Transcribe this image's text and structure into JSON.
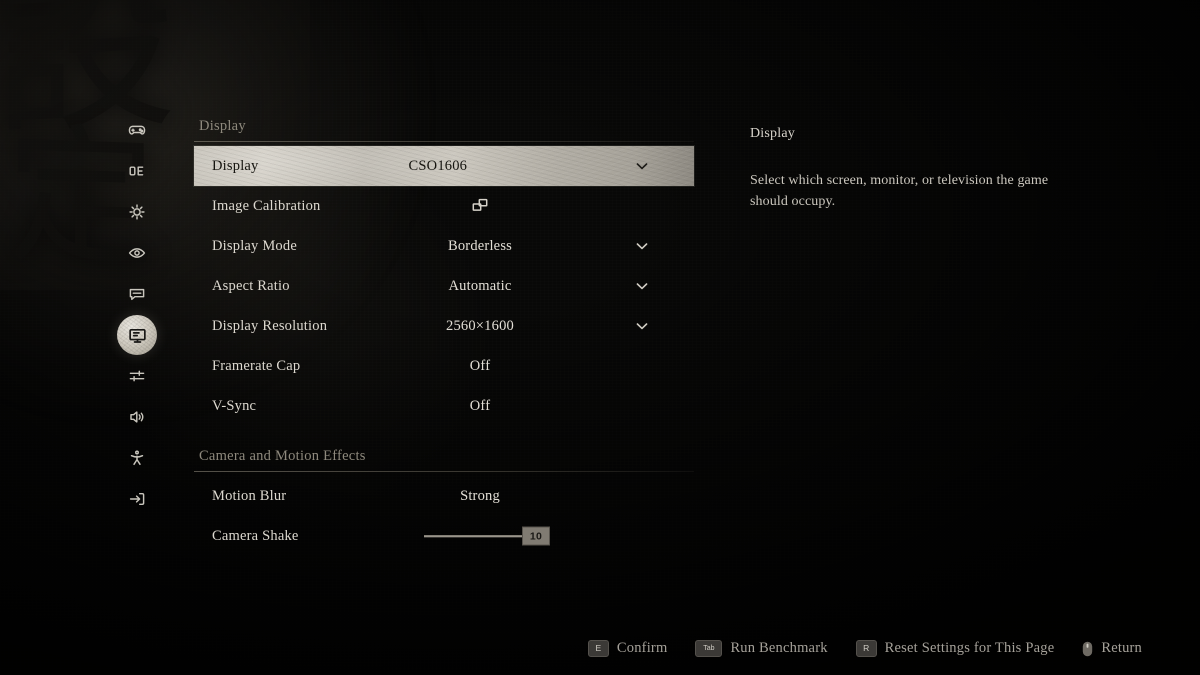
{
  "background": {
    "calligraphy_top": "設",
    "calligraphy_bottom": "定"
  },
  "sidebar": {
    "items": [
      {
        "id": "gameplay",
        "icon": "gamepad-icon",
        "active": false
      },
      {
        "id": "controls",
        "icon": "keyboard-keys-icon",
        "active": false
      },
      {
        "id": "graphics",
        "icon": "gear-icon",
        "active": false
      },
      {
        "id": "visuals",
        "icon": "eye-icon",
        "active": false
      },
      {
        "id": "language",
        "icon": "speech-bubble-icon",
        "active": false
      },
      {
        "id": "display",
        "icon": "monitor-icon",
        "active": true
      },
      {
        "id": "adjustments",
        "icon": "sliders-icon",
        "active": false
      },
      {
        "id": "audio",
        "icon": "speaker-icon",
        "active": false
      },
      {
        "id": "accessibility",
        "icon": "accessibility-icon",
        "active": false
      },
      {
        "id": "exit",
        "icon": "exit-arrow-icon",
        "active": false
      }
    ]
  },
  "settings": {
    "sections": [
      {
        "title": "Display",
        "rows": [
          {
            "label": "Display",
            "value": "CSO1606",
            "control": "dropdown",
            "selected": true
          },
          {
            "label": "Image Calibration",
            "value": "",
            "control": "screens-icon",
            "selected": false
          },
          {
            "label": "Display Mode",
            "value": "Borderless",
            "control": "dropdown",
            "selected": false
          },
          {
            "label": "Aspect Ratio",
            "value": "Automatic",
            "control": "dropdown",
            "selected": false
          },
          {
            "label": "Display Resolution",
            "value": "2560×1600",
            "control": "dropdown",
            "selected": false
          },
          {
            "label": "Framerate Cap",
            "value": "Off",
            "control": "text",
            "selected": false
          },
          {
            "label": "V-Sync",
            "value": "Off",
            "control": "text",
            "selected": false
          }
        ]
      },
      {
        "title": "Camera and Motion Effects",
        "rows": [
          {
            "label": "Motion Blur",
            "value": "Strong",
            "control": "text",
            "selected": false
          },
          {
            "label": "Camera Shake",
            "value": "10",
            "control": "slider",
            "selected": false,
            "slider_min": 0,
            "slider_max": 10
          }
        ]
      }
    ]
  },
  "description": {
    "title": "Display",
    "body": "Select which screen, monitor, or television the game should occupy."
  },
  "footer": {
    "prompts": [
      {
        "key": "E",
        "key_style": "narrow",
        "label": "Confirm"
      },
      {
        "key": "Tab",
        "key_style": "wide",
        "label": "Run Benchmark"
      },
      {
        "key": "R",
        "key_style": "narrow",
        "label": "Reset Settings for This Page"
      },
      {
        "key": "",
        "key_style": "mouse",
        "label": "Return"
      }
    ]
  },
  "colors": {
    "background": "#080807",
    "text_primary": "#ddd9d0",
    "text_muted": "#8e897d",
    "selection_light": "#cbc7be",
    "selection_text": "#15140f"
  }
}
